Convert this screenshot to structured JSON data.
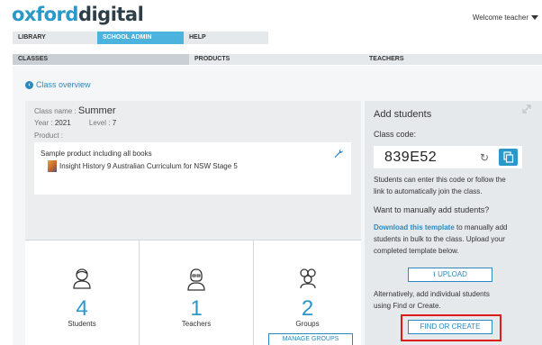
{
  "header": {
    "logo_part1": "oxford",
    "logo_part2": "digital",
    "welcome": "Welcome teacher"
  },
  "topnav": [
    "LIBRARY",
    "SCHOOL ADMIN",
    "HELP"
  ],
  "subnav": [
    "CLASSES",
    "PRODUCTS",
    "TEACHERS"
  ],
  "back_link": "Class overview",
  "class_info": {
    "name_label": "Class name :",
    "name": "Summer",
    "year_label": "Year :",
    "year": "2021",
    "level_label": "Level :",
    "level": "7",
    "product_label": "Product :"
  },
  "product": {
    "heading": "Sample product including all books",
    "book": "Insight History 9 Australian Curriculum for NSW Stage 5"
  },
  "stats": [
    {
      "value": "4",
      "label": "Students",
      "icon": "student-icon"
    },
    {
      "value": "1",
      "label": "Teachers",
      "icon": "teacher-icon"
    },
    {
      "value": "2",
      "label": "Groups",
      "icon": "groups-icon"
    }
  ],
  "manage_groups": "MANAGE GROUPS",
  "add_students": {
    "title": "Add students",
    "code_label": "Class code:",
    "code": "839E52",
    "code_help_1": "Students can enter this code or follow the",
    "code_help_2": "link to automatically join the class.",
    "manual_heading": "Want to manually add students?",
    "template_link": "Download this template",
    "template_text_1": " to manually add",
    "template_text_2": "students in bulk to the class. Upload your",
    "template_text_3": "completed template below.",
    "upload": "UPLOAD",
    "alt_text_1": "Alternatively, add individual students",
    "alt_text_2": "using Find or Create.",
    "find_create": "FIND OR CREATE"
  },
  "colors": {
    "accent": "#2a98c8",
    "highlight": "#e01b1b"
  }
}
